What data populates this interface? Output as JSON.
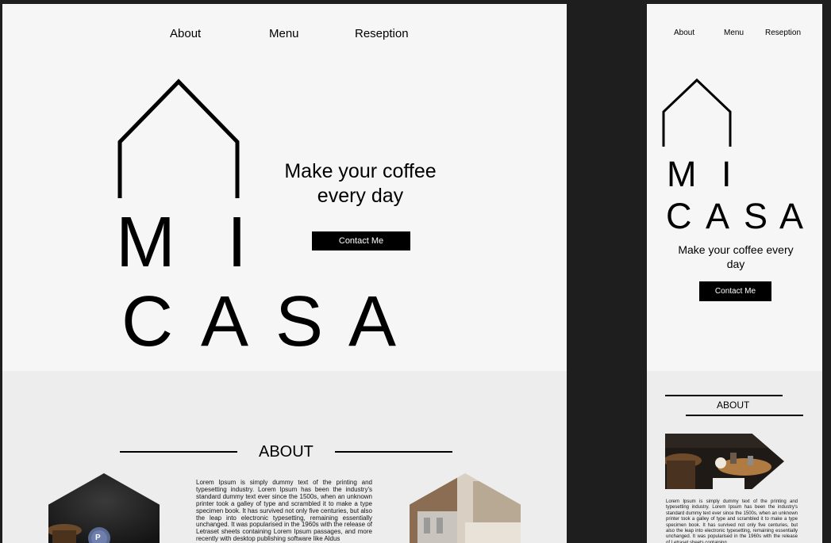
{
  "desktop": {
    "nav": {
      "about": "About",
      "menu": "Menu",
      "reception": "Reseption"
    },
    "brand": {
      "line1": [
        "M",
        "I"
      ],
      "line2": [
        "C",
        "A",
        "S",
        "A"
      ]
    },
    "hero": {
      "tagline_line1": "Make your coffee",
      "tagline_line2": "every day",
      "cta_label": "Contact Me"
    },
    "about": {
      "heading": "ABOUT",
      "body": "Lorem Ipsum is simply dummy text of the printing and typesetting industry. Lorem Ipsum has been the industry's standard dummy text ever since the 1500s, when an unknown printer took a galley of type and scrambled it to make a type specimen book. It has survived not only five centuries, but also the leap into electronic typesetting, remaining essentially unchanged. It was popularised in the 1960s with the release of Letraset sheets containing Lorem Ipsum passages, and more recently with desktop publishing software like Aldus",
      "badge_letter": "P"
    }
  },
  "mobile": {
    "nav": {
      "about": "About",
      "menu": "Menu",
      "reception": "Reseption"
    },
    "brand": {
      "line1": [
        "M",
        "I"
      ],
      "line2": [
        "C",
        "A",
        "S",
        "A"
      ]
    },
    "hero": {
      "tagline_line1": "Make your coffee every",
      "tagline_line2": "day",
      "cta_label": "Contact Me"
    },
    "about": {
      "heading": "ABOUT",
      "body": "Lorem Ipsum is simply dummy text of the printing and typesetting industry. Lorem Ipsum has been the industry's standard dummy text ever since the 1500s, when an unknown printer took a galley of type and scrambled it to make a type specimen book. It has survived not only five centuries, but also the leap into electronic typesetting, remaining essentially unchanged. It was popularised in the 1960s with the release of Letraset sheets containing"
    }
  },
  "colors": {
    "canvas": "#1e1e1e",
    "hero_bg": "#f6f6f6",
    "about_bg": "#ededed",
    "ink": "#000000",
    "button_text": "#ffffff"
  },
  "icons": {
    "brand_mark": "house-outline-icon"
  }
}
